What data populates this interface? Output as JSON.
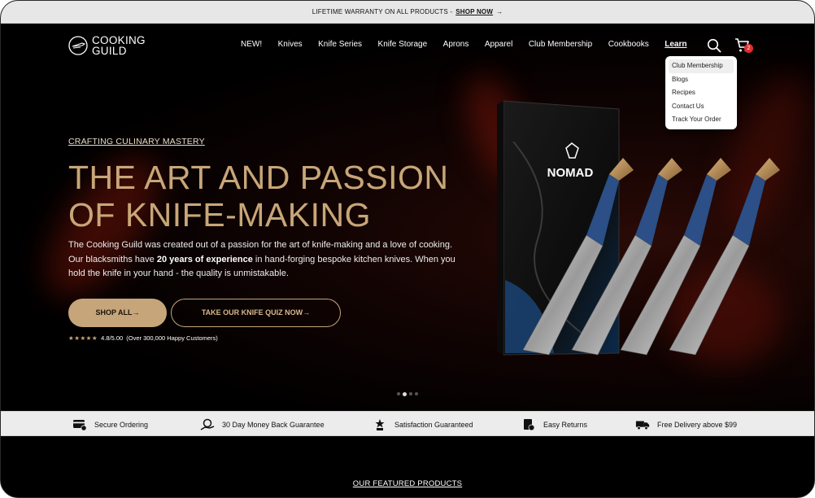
{
  "announcement": {
    "text": "LIFETIME WARRANTY ON ALL PRODUCTS -",
    "link": "SHOP NOW",
    "arrow": "→"
  },
  "brand": {
    "line1": "COOKING",
    "line2": "GUILD",
    "logo_icon": "knife-logo-icon"
  },
  "nav": {
    "items": [
      "NEW!",
      "Knives",
      "Knife Series",
      "Knife Storage",
      "Aprons",
      "Apparel",
      "Club Membership",
      "Cookbooks",
      "Learn"
    ],
    "active": "Learn"
  },
  "cart": {
    "count": "2"
  },
  "learn_menu": {
    "items": [
      "Club Membership",
      "Blogs",
      "Recipes",
      "Contact Us",
      "Track Your Order"
    ],
    "highlighted": "Club Membership"
  },
  "hero": {
    "eyebrow": "CRAFTING CULINARY MASTERY",
    "headline_line1": "THE ART AND PASSION",
    "headline_line2": "OF KNIFE-MAKING",
    "desc_part1": "The Cooking Guild was created out of a passion for the art of knife-making and a love of cooking. Our blacksmiths have ",
    "desc_bold": "20 years of experience",
    "desc_part2": " in hand-forging bespoke kitchen knives. When you hold the knife in your hand - the quality is unmistakable.",
    "primary_button": "SHOP ALL→",
    "secondary_button": "TAKE OUR KNIFE QUIZ NOW→",
    "stars": "★★★★★",
    "rating": "4.8/5.00",
    "rating_note": "(Over 300,000 Happy Customers)",
    "product_box_label": "NOMAD",
    "slides": {
      "total": 4,
      "current": 2
    }
  },
  "trust": [
    {
      "label": "Secure Ordering",
      "icon": "secure-card-icon"
    },
    {
      "label": "30 Day Money Back Guarantee",
      "icon": "money-back-icon"
    },
    {
      "label": "Satisfaction Guaranteed",
      "icon": "satisfaction-icon"
    },
    {
      "label": "Easy Returns",
      "icon": "returns-icon"
    },
    {
      "label": "Free Delivery above $99",
      "icon": "delivery-truck-icon"
    }
  ],
  "featured": {
    "title": "OUR FEATURED PRODUCTS"
  },
  "colors": {
    "accent_gold": "#c6a57a",
    "headline_gold": "#c8a678",
    "badge_red": "#e12d2d"
  }
}
